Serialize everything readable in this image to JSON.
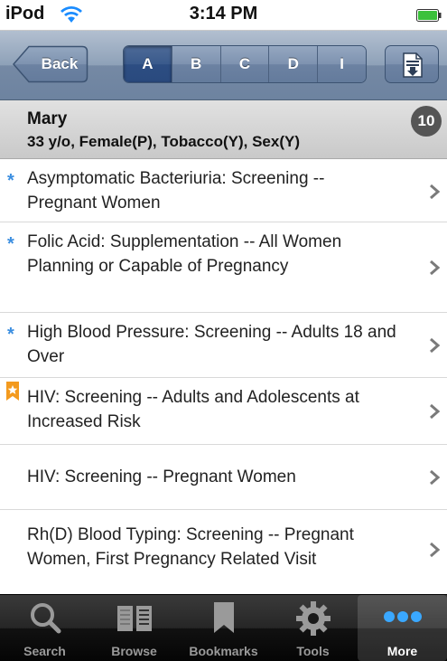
{
  "status_bar": {
    "carrier": "iPod",
    "time": "3:14 PM"
  },
  "nav": {
    "back_label": "Back",
    "segments": [
      {
        "label": "A",
        "selected": true
      },
      {
        "label": "B",
        "selected": false
      },
      {
        "label": "C",
        "selected": false
      },
      {
        "label": "D",
        "selected": false
      },
      {
        "label": "I",
        "selected": false
      }
    ]
  },
  "patient": {
    "name": "Mary",
    "details": "33 y/o, Female(P), Tobacco(Y), Sex(Y)",
    "count": "10"
  },
  "list": [
    {
      "marker": "star",
      "title": "Asymptomatic Bacteriuria: Screening -- Pregnant Women"
    },
    {
      "marker": "star",
      "title": "Folic Acid: Supplementation -- All Women Planning or Capable of Pregnancy"
    },
    {
      "marker": "star",
      "title": "High Blood Pressure: Screening -- Adults 18 and Over"
    },
    {
      "marker": "bookmark",
      "title": "HIV: Screening -- Adults and Adolescents at Increased Risk"
    },
    {
      "marker": "none",
      "title": "HIV: Screening -- Pregnant Women"
    },
    {
      "marker": "none",
      "title": "Rh(D) Blood Typing: Screening -- Pregnant Women, First Pregnancy Related Visit"
    }
  ],
  "tab_bar": {
    "tabs": [
      {
        "label": "Search",
        "icon": "search-icon",
        "active": false
      },
      {
        "label": "Browse",
        "icon": "book-icon",
        "active": false
      },
      {
        "label": "Bookmarks",
        "icon": "bookmark-icon",
        "active": false
      },
      {
        "label": "Tools",
        "icon": "gear-icon",
        "active": false
      },
      {
        "label": "More",
        "icon": "more-dots-icon",
        "active": true
      }
    ]
  },
  "colors": {
    "star": "#3b8ee0",
    "bookmark": "#f39a1e",
    "nav_selected": "#2c4d82",
    "active_dots": "#3aa8ff"
  }
}
